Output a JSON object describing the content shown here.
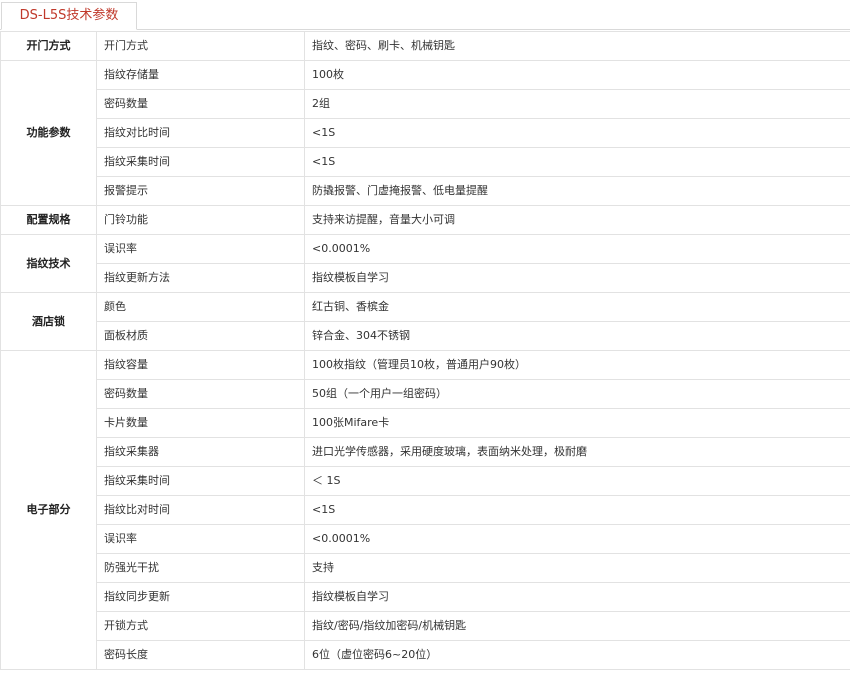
{
  "tab": {
    "label": "DS-L5S技术参数"
  },
  "sections": [
    {
      "category": "开门方式",
      "rows": [
        {
          "param": "开门方式",
          "value": "指纹、密码、刷卡、机械钥匙"
        }
      ]
    },
    {
      "category": "功能参数",
      "rows": [
        {
          "param": "指纹存储量",
          "value": "100枚"
        },
        {
          "param": "密码数量",
          "value": "2组"
        },
        {
          "param": "指纹对比时间",
          "value": "<1S"
        },
        {
          "param": "指纹采集时间",
          "value": "<1S"
        },
        {
          "param": "报警提示",
          "value": "防撬报警、门虚掩报警、低电量提醒"
        }
      ]
    },
    {
      "category": "配置规格",
      "rows": [
        {
          "param": "门铃功能",
          "value": "支持来访提醒，音量大小可调"
        }
      ]
    },
    {
      "category": "指纹技术",
      "rows": [
        {
          "param": "误识率",
          "value": "<0.0001%"
        },
        {
          "param": "指纹更新方法",
          "value": "指纹模板自学习"
        }
      ]
    },
    {
      "category": "酒店锁",
      "rows": [
        {
          "param": "颜色",
          "value": "红古铜、香槟金"
        },
        {
          "param": "面板材质",
          "value": "锌合金、304不锈钢"
        }
      ]
    },
    {
      "category": "电子部分",
      "rows": [
        {
          "param": "指纹容量",
          "value": "100枚指纹（管理员10枚，普通用户90枚）"
        },
        {
          "param": "密码数量",
          "value": "50组（一个用户一组密码）"
        },
        {
          "param": "卡片数量",
          "value": "100张Mifare卡"
        },
        {
          "param": "指纹采集器",
          "value": "进口光学传感器，采用硬度玻璃，表面纳米处理，极耐磨"
        },
        {
          "param": "指纹采集时间",
          "value": "＜ 1S"
        },
        {
          "param": "指纹比对时间",
          "value": "<1S"
        },
        {
          "param": "误识率",
          "value": "<0.0001%"
        },
        {
          "param": "防强光干扰",
          "value": "支持"
        },
        {
          "param": "指纹同步更新",
          "value": "指纹模板自学习"
        },
        {
          "param": "开锁方式",
          "value": "指纹/密码/指纹加密码/机械钥匙"
        },
        {
          "param": "密码长度",
          "value": "6位（虚位密码6~20位）"
        }
      ]
    }
  ]
}
